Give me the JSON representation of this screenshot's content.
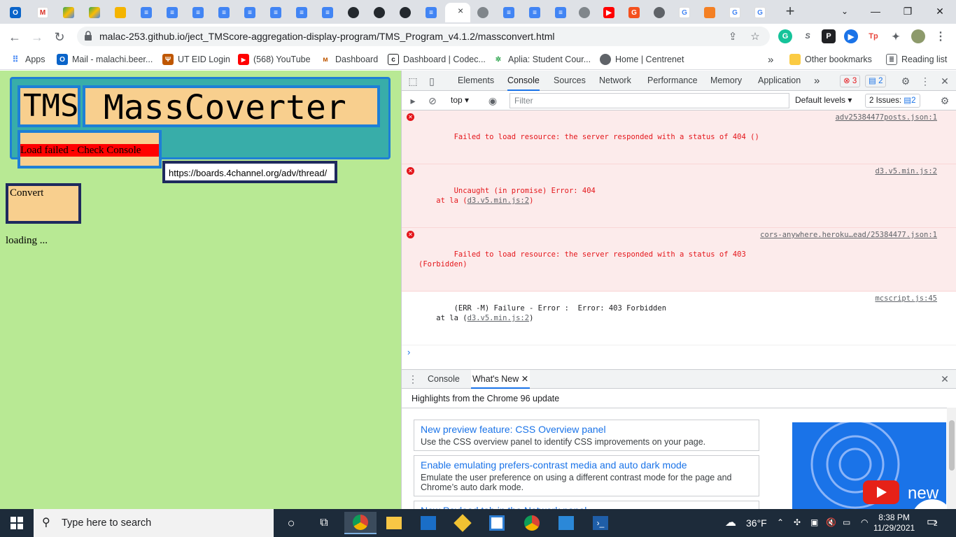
{
  "tabs": {
    "active_close": "×",
    "new_tab": "+"
  },
  "window": {
    "minimize": "—",
    "restore": "❐",
    "close": "✕"
  },
  "address": {
    "url": "malac-253.github.io/ject_TMScore-aggregation-display-program/TMS_Program_v4.1.2/massconvert.html"
  },
  "extensions": {
    "s_label": "S",
    "p_label": "P",
    "tp_label": "Tp"
  },
  "bookmarks": {
    "apps": "Apps",
    "mail": "Mail - malachi.beer...",
    "uteid": "UT EID Login",
    "youtube": "(568) YouTube",
    "dashboard": "Dashboard",
    "codecademy": "Dashboard | Codec...",
    "aplia": "Aplia: Student Cour...",
    "centrenet": "Home | Centrenet",
    "more": "»",
    "other": "Other bookmarks",
    "reading": "Reading list"
  },
  "page": {
    "tms_title": "TMS",
    "mass_title": "MassCoverter",
    "load_status": "Load failed - Check Console",
    "url_value": "https://boards.4channel.org/adv/thread/",
    "convert_label": "Convert",
    "loading_text": "loading ..."
  },
  "devtools": {
    "tabs": [
      "Elements",
      "Console",
      "Sources",
      "Network",
      "Performance",
      "Memory",
      "Application"
    ],
    "more_tabs": "»",
    "error_count": "3",
    "message_count": "2",
    "context": "top",
    "filter_placeholder": "Filter",
    "levels": "Default levels",
    "issues_label": "2 Issues:",
    "issues_count": "2",
    "messages": [
      {
        "type": "err",
        "text": "Failed to load resource: the server responded with a status of 404 ()",
        "source": "adv25384477posts.json:1"
      },
      {
        "type": "err",
        "text": "Uncaught (in promise) Error: 404",
        "text2_prefix": "    at la (",
        "text2_link": "d3.v5.min.js:2",
        "text2_suffix": ")",
        "source": "d3.v5.min.js:2"
      },
      {
        "type": "err",
        "text": "Failed to load resource: the server responded with a status of 403\n(Forbidden)",
        "source": "cors-anywhere.heroku…ead/25384477.json:1"
      },
      {
        "type": "log",
        "text": "(ERR -M) Failure - Error :  Error: 403 Forbidden",
        "text2_prefix": "    at la (",
        "text2_link": "d3.v5.min.js:2",
        "text2_suffix": ")",
        "source": "mcscript.js:45"
      }
    ],
    "prompt": "›",
    "drawer": {
      "tab_console": "Console",
      "tab_whatsnew": "What's New",
      "subtitle": "Highlights from the Chrome 96 update",
      "cards": [
        {
          "title": "New preview feature: CSS Overview panel",
          "desc": "Use the CSS overview panel to identify CSS improvements on your page."
        },
        {
          "title": "Enable emulating prefers-contrast media and auto dark mode",
          "desc": "Emulate the user preference on using a different contrast mode for the page and Chrome’s auto dark mode."
        },
        {
          "title": "New Payload tab in the Network panel",
          "desc": ""
        }
      ],
      "video_text": "new"
    }
  },
  "taskbar": {
    "search_placeholder": "Type here to search",
    "temperature": "36°F",
    "time": "8:38 PM",
    "date": "11/29/2021",
    "notification_count": "2"
  },
  "colors": {
    "page_bg": "#b8e994",
    "header_bg": "#38ada9",
    "box_fill": "#f8cf8e",
    "box_border": "#1e7fd6",
    "error_red": "#e4161b"
  }
}
